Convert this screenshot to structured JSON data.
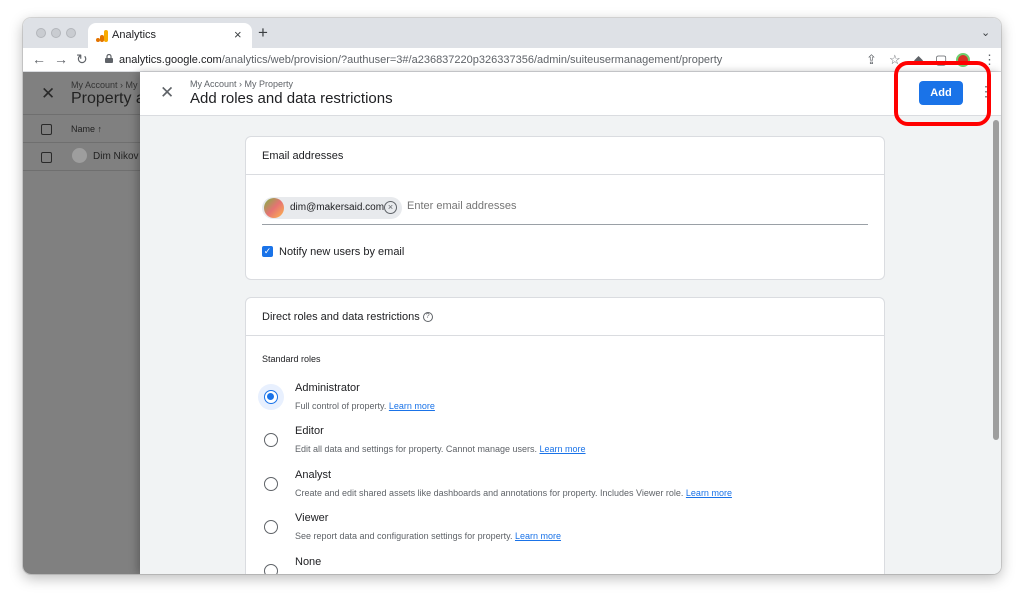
{
  "browser": {
    "tab_title": "Analytics",
    "new_tab": "+",
    "url_host": "analytics.google.com",
    "url_path": "/analytics/web/provision/?authuser=3#/a236837220p326337356/admin/suiteusermanagement/property"
  },
  "background_panel": {
    "breadcrumb": "My Account › My P",
    "title": "Property a",
    "column_name": "Name ↑",
    "user_name": "Dim Nikov"
  },
  "drawer": {
    "breadcrumb": "My Account › My Property",
    "title": "Add roles and data restrictions",
    "add_label": "Add"
  },
  "email_card": {
    "heading": "Email addresses",
    "chip_email": "dim@makersaid.com",
    "input_placeholder": "Enter email addresses",
    "notify_label": "Notify new users by email",
    "notify_checked": true
  },
  "roles_card": {
    "heading": "Direct roles and data restrictions",
    "subheading": "Standard roles",
    "learn_more": "Learn more",
    "roles": [
      {
        "name": "Administrator",
        "desc": "Full control of property.",
        "selected": true
      },
      {
        "name": "Editor",
        "desc": "Edit all data and settings for property. Cannot manage users.",
        "selected": false
      },
      {
        "name": "Analyst",
        "desc": "Create and edit shared assets like dashboards and annotations for property. Includes Viewer role.",
        "selected": false
      },
      {
        "name": "Viewer",
        "desc": "See report data and configuration settings for property.",
        "selected": false
      },
      {
        "name": "None",
        "desc": "",
        "selected": false
      }
    ]
  },
  "colors": {
    "accent": "#1a73e8",
    "highlight": "#ff0000"
  }
}
